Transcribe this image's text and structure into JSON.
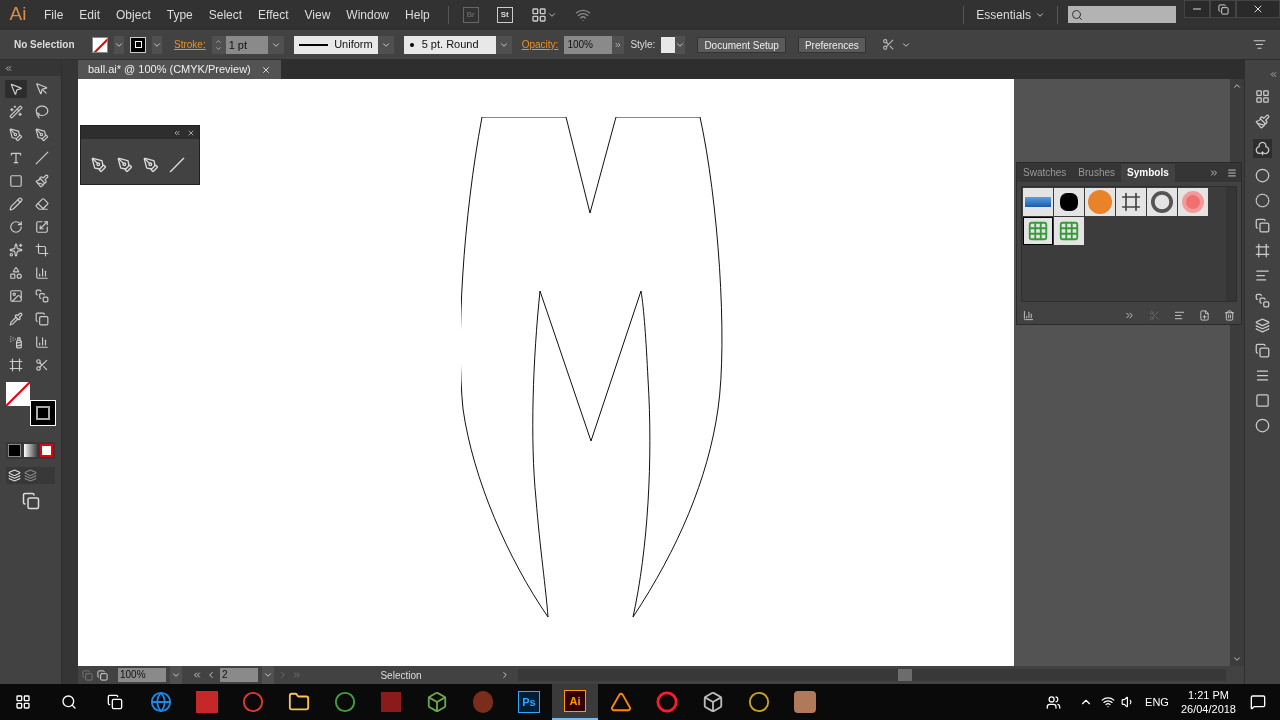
{
  "app": {
    "logo": "Ai",
    "menu": [
      "File",
      "Edit",
      "Object",
      "Type",
      "Select",
      "Effect",
      "View",
      "Window",
      "Help"
    ],
    "bridge": "Br",
    "stock": "St",
    "workspace": "Essentials"
  },
  "control_bar": {
    "selection": "No Selection",
    "stroke_label": "Stroke:",
    "stroke_weight": "1 pt",
    "profile": "Uniform",
    "brush": "5 pt. Round",
    "opacity_label": "Opacity:",
    "opacity": "100%",
    "style_label": "Style:",
    "buttons": [
      "Document Setup",
      "Preferences"
    ]
  },
  "document_tab": {
    "title": "ball.ai* @ 100% (CMYK/Preview)",
    "selected": true
  },
  "tools": [
    {
      "selected": true
    },
    {
      "selected": false
    },
    {
      "selected": false
    },
    {
      "selected": false
    },
    {
      "selected": false
    },
    {
      "selected": false
    },
    {
      "selected": false
    },
    {
      "selected": false
    },
    {
      "selected": false
    },
    {
      "selected": false
    },
    {
      "selected": false
    },
    {
      "selected": false
    },
    {
      "selected": false
    },
    {
      "selected": false
    },
    {
      "selected": false
    },
    {
      "selected": false
    },
    {
      "selected": false
    },
    {
      "selected": false
    },
    {
      "selected": false
    },
    {
      "selected": false
    },
    {
      "selected": false
    },
    {
      "selected": false
    },
    {
      "selected": false
    },
    {
      "selected": false
    },
    {
      "selected": false
    },
    {
      "selected": false
    }
  ],
  "panel": {
    "tabs": [
      {
        "label": "Swatches",
        "selected": false
      },
      {
        "label": "Brushes",
        "selected": false
      },
      {
        "label": "Symbols",
        "selected": true
      }
    ]
  },
  "status_bar": {
    "zoom": "100%",
    "artboard": "2",
    "tool": "Selection"
  },
  "taskbar": {
    "apps": [
      {
        "kind": "edge",
        "selected": false
      },
      {
        "kind": "autocad",
        "selected": false
      },
      {
        "kind": "media",
        "selected": false
      },
      {
        "kind": "folder",
        "selected": false
      },
      {
        "kind": "chrome",
        "selected": false
      },
      {
        "kind": "game",
        "selected": false
      },
      {
        "kind": "block",
        "selected": false
      },
      {
        "kind": "figure",
        "selected": false
      },
      {
        "kind": "ps",
        "label": "Ps",
        "selected": false
      },
      {
        "kind": "ai",
        "label": "Ai",
        "selected": true
      },
      {
        "kind": "vlc",
        "selected": false
      },
      {
        "kind": "opera",
        "selected": false
      },
      {
        "kind": "drive",
        "selected": false
      },
      {
        "kind": "emblem",
        "selected": false
      },
      {
        "kind": "portrait",
        "selected": false
      }
    ],
    "language": "ENG",
    "time": "1:21 PM",
    "date": "26/04/2018"
  }
}
